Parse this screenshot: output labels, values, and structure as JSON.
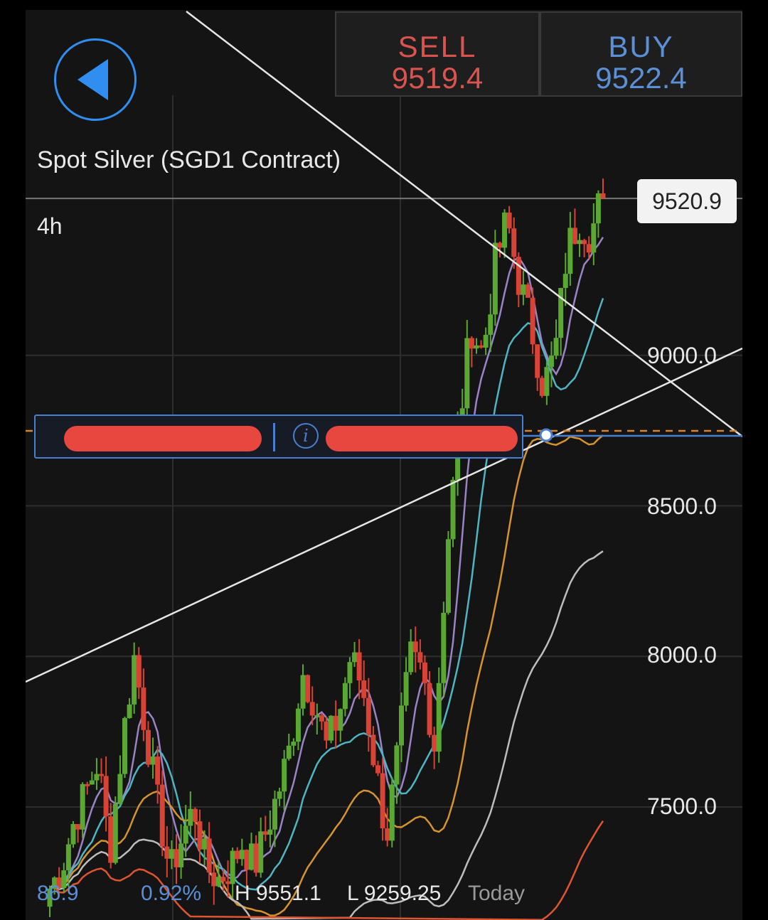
{
  "header": {
    "sell_label": "SELL",
    "sell_price": "9519.4",
    "buy_label": "BUY",
    "buy_price": "9522.4"
  },
  "instrument": {
    "title": "Spot Silver (SGD1 Contract)",
    "timeframe": "4h",
    "current_price": "9520.9"
  },
  "price_axis": {
    "labels": [
      "9000.0",
      "8500.0",
      "8000.0",
      "7500.0"
    ]
  },
  "footer_stats": {
    "value_1": "86.9",
    "value_2": "0.92%",
    "high": "H 9551.1",
    "low": "L 9259.25",
    "period": "Today"
  },
  "icons": {
    "back": "back-arrow-icon",
    "info": "info-icon"
  },
  "colors": {
    "sell": "#d9534f",
    "buy": "#5b8fd6",
    "candle_up": "#5aa832",
    "candle_down": "#d94336",
    "ma_purple": "#9a84c6",
    "ma_cyan": "#4fb5c4",
    "ma_orange": "#d6932e",
    "ma_gray": "#bdbdbd",
    "ma_red": "#e0542f"
  },
  "chart_data": {
    "type": "candlestick",
    "timeframe": "4h",
    "y_ticks": [
      7500,
      8000,
      8500,
      9000
    ],
    "ylim": [
      7250,
      9950
    ],
    "current_price": 9520.9,
    "candle_count": 119,
    "series_close_estimate": [
      7230,
      7300,
      7450,
      7550,
      7650,
      7350,
      7700,
      8000,
      7750,
      7500,
      7280,
      7400,
      7500,
      7300,
      7260,
      7300,
      7380,
      7300,
      7420,
      7550,
      7700,
      7950,
      7850,
      7700,
      7800,
      8000,
      7900,
      7650,
      7400,
      7700,
      8000,
      7950,
      7700,
      8350,
      8750,
      9100,
      9000,
      9300,
      9450,
      9250,
      9100,
      8900,
      9000,
      9350,
      9450,
      9400,
      9550
    ]
  }
}
